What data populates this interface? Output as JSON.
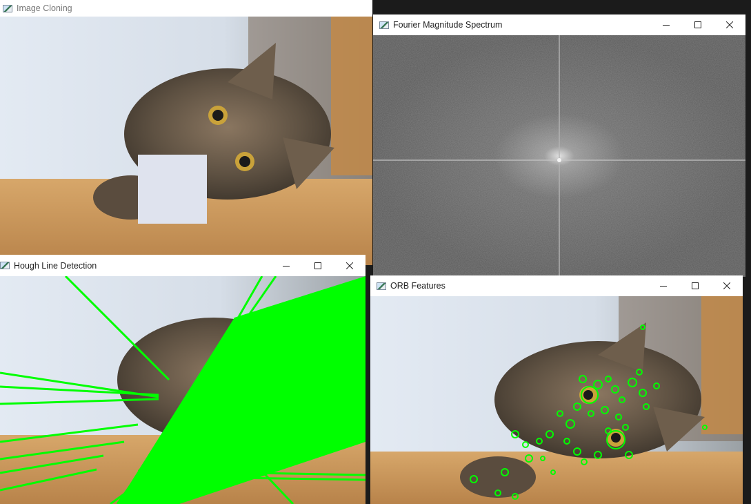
{
  "windows": {
    "cloning": {
      "title": "Image Cloning"
    },
    "fourier": {
      "title": "Fourier Magnitude Spectrum"
    },
    "hough": {
      "title": "Hough Line Detection"
    },
    "orb": {
      "title": "ORB Features"
    }
  },
  "icons": {
    "window_icon": "app-window-icon",
    "minimize": "minimize-icon",
    "maximize": "maximize-icon",
    "close": "close-icon"
  },
  "colors": {
    "feature_green": "#00ff00",
    "spectrum_gray": "#5e5e5e",
    "pasted_patch": "#dfe3ee"
  }
}
